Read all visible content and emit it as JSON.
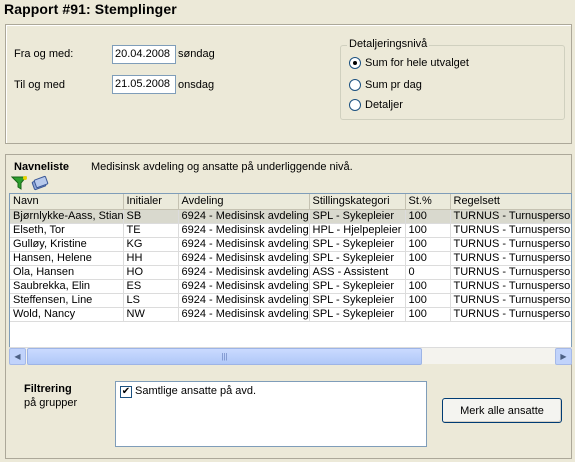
{
  "window": {
    "title": "Rapport #91: Stemplinger"
  },
  "period": {
    "from_label": "Fra og med:",
    "from_value": "20.04.2008",
    "from_weekday": "søndag",
    "to_label": "Til og med",
    "to_value": "21.05.2008",
    "to_weekday": "onsdag"
  },
  "detail_level": {
    "title": "Detaljeringsnivå",
    "options": [
      {
        "label": "Sum for hele utvalget",
        "selected": true
      },
      {
        "label": "Sum pr dag",
        "selected": false
      },
      {
        "label": "Detaljer",
        "selected": false
      }
    ]
  },
  "name_list": {
    "title": "Navneliste",
    "description": "Medisinsk avdeling og ansatte på underliggende nivå.",
    "icons": [
      "filter-funnel-icon",
      "books-icon"
    ],
    "columns": [
      "Navn",
      "Initialer",
      "Avdeling",
      "Stillingskategori",
      "St.%",
      "Regelsett"
    ],
    "rows": [
      [
        "Bjørnlykke-Aass, Stian",
        "SB",
        "6924 - Medisinsk avdeling",
        "SPL - Sykepleier",
        "100",
        "TURNUS - Turnuspersonal"
      ],
      [
        "Elseth, Tor",
        "TE",
        "6924 - Medisinsk avdeling",
        "HPL - Hjelpepleier",
        "100",
        "TURNUS - Turnuspersonal"
      ],
      [
        "Gulløy, Kristine",
        "KG",
        "6924 - Medisinsk avdeling",
        "SPL - Sykepleier",
        "100",
        "TURNUS - Turnuspersonal"
      ],
      [
        "Hansen, Helene",
        "HH",
        "6924 - Medisinsk avdeling",
        "SPL - Sykepleier",
        "100",
        "TURNUS - Turnuspersonal"
      ],
      [
        "Ola, Hansen",
        "HO",
        "6924 - Medisinsk avdeling",
        "ASS - Assistent",
        "0",
        "TURNUS - Turnuspersonal"
      ],
      [
        "Saubrekka, Elin",
        "ES",
        "6924 - Medisinsk avdeling",
        "SPL - Sykepleier",
        "100",
        "TURNUS - Turnuspersonal"
      ],
      [
        "Steffensen, Line",
        "LS",
        "6924 - Medisinsk avdeling",
        "SPL - Sykepleier",
        "100",
        "TURNUS - Turnuspersonal"
      ],
      [
        "Wold, Nancy",
        "NW",
        "6924 - Medisinsk avdeling",
        "SPL - Sykepleier",
        "100",
        "TURNUS - Turnuspersonal"
      ]
    ]
  },
  "filter": {
    "title": "Filtrering",
    "subtitle": "på grupper",
    "checkbox_label": "Samtlige ansatte på avd.",
    "checked": true,
    "mark_all_button": "Merk alle ansatte"
  }
}
